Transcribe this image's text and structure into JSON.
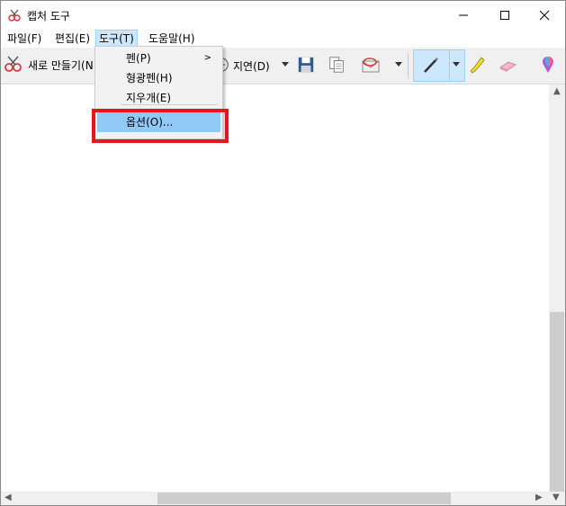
{
  "window": {
    "title": "캡처 도구",
    "icon": "snipping-tool-icon"
  },
  "menubar": {
    "file": "파일(F)",
    "edit": "편집(E)",
    "tools": "도구(T)",
    "help": "도움말(H)"
  },
  "toolbar": {
    "new_label": "새로 만들기(N",
    "delay_label": "지연(D)",
    "icons": [
      "scissors-icon",
      "clock-icon",
      "save-icon",
      "copy-icon",
      "send-email-icon",
      "pen-icon",
      "highlighter-icon",
      "eraser-icon",
      "paint3d-icon"
    ]
  },
  "tools_menu": {
    "items": [
      {
        "label": "펜(P)",
        "has_submenu": true
      },
      {
        "label": "형광펜(H)",
        "has_submenu": false
      },
      {
        "label": "지우개(E)",
        "has_submenu": false
      },
      {
        "label": "옵션(O)...",
        "has_submenu": false,
        "highlighted": true
      }
    ]
  },
  "colors": {
    "highlight": "#e8141f",
    "menu_hover": "#91c9f7",
    "active_menu": "#cce8ff"
  }
}
